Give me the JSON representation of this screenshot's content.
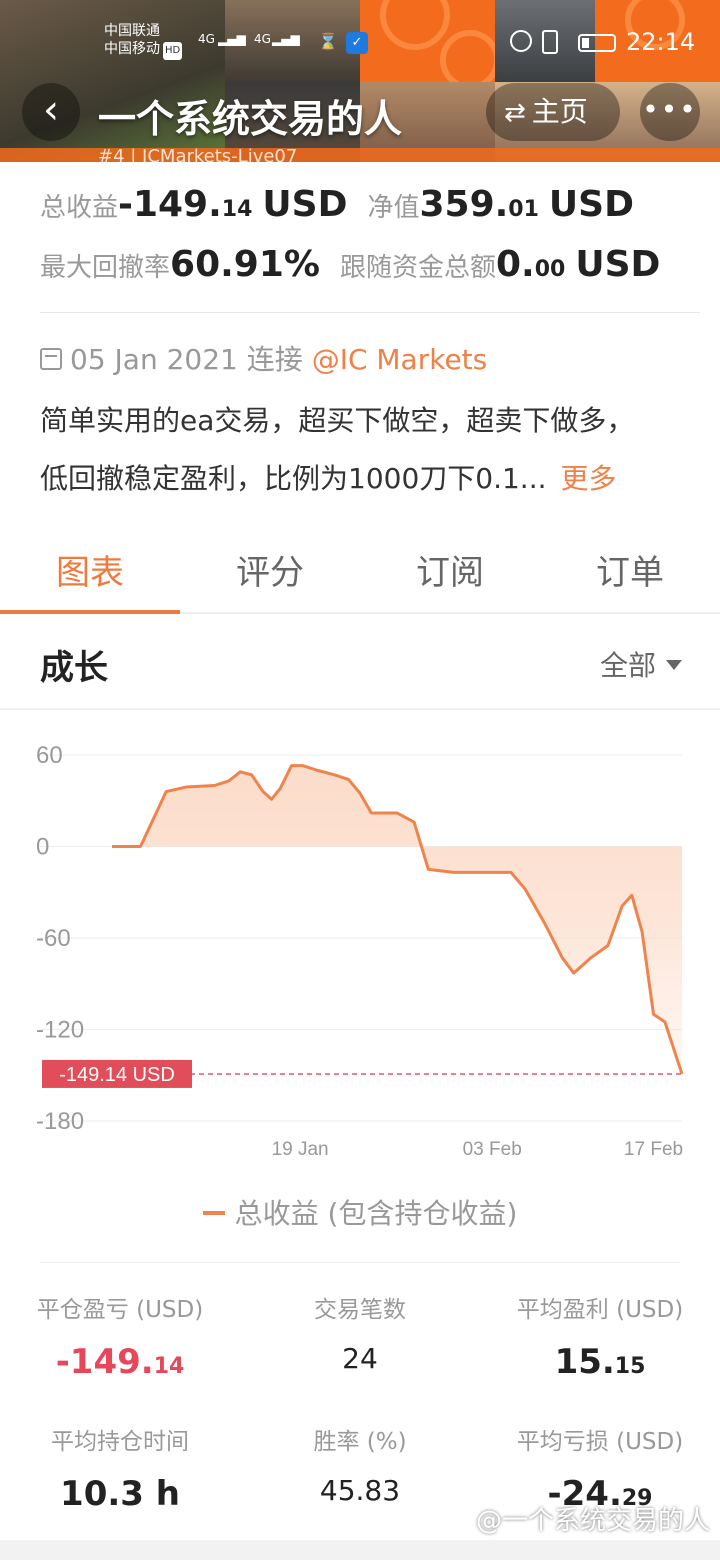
{
  "status_bar": {
    "carrier_1": "中国联通",
    "carrier_2": "中国移动",
    "hd": "HD",
    "network_1": "4G",
    "network_2": "4G",
    "time": "22:14"
  },
  "nav": {
    "title": "一个系统交易的人",
    "home_label": "主页",
    "subtitle": "#4 | ICMarkets-Live07"
  },
  "stats": {
    "total_profit_label": "总收益",
    "total_profit_int": "-149.",
    "total_profit_dec": "14",
    "total_profit_unit": "USD",
    "equity_label": "净值",
    "equity_int": "359.",
    "equity_dec": "01",
    "equity_unit": "USD",
    "max_drawdown_label": "最大回撤率",
    "max_drawdown_value": "60.91%",
    "follow_funds_label": "跟随资金总额",
    "follow_funds_int": "0.",
    "follow_funds_dec": "00",
    "follow_funds_unit": "USD"
  },
  "connect": {
    "date": "05 Jan 2021",
    "text": "连接",
    "broker": "@IC Markets"
  },
  "description": {
    "line1": "简单实用的ea交易，超买下做空，超卖下做多，",
    "line2": "低回撤稳定盈利，比例为1000刀下0.1...",
    "more": "更多"
  },
  "tabs": [
    {
      "label": "图表",
      "active": true
    },
    {
      "label": "评分",
      "active": false
    },
    {
      "label": "订阅",
      "active": false
    },
    {
      "label": "订单",
      "active": false
    }
  ],
  "growth": {
    "title": "成长",
    "range": "全部"
  },
  "chart_data": {
    "type": "area",
    "y_ticks": [
      "60",
      "0",
      "-60",
      "-120",
      "-180"
    ],
    "ylim": [
      -180,
      60
    ],
    "x_ticks": [
      "19 Jan",
      "03 Feb",
      "17 Feb"
    ],
    "current_label": "-149.14 USD",
    "current_value": -149.14,
    "legend": "总收益 (包含持仓收益)",
    "line_color": "#f0834b",
    "fill_color": "#fbd0b8",
    "series": [
      {
        "name": "总收益 (包含持仓收益)",
        "points": [
          [
            0.0,
            0
          ],
          [
            0.05,
            0
          ],
          [
            0.075,
            20
          ],
          [
            0.095,
            36
          ],
          [
            0.13,
            39
          ],
          [
            0.18,
            40
          ],
          [
            0.205,
            43
          ],
          [
            0.225,
            49
          ],
          [
            0.245,
            47
          ],
          [
            0.265,
            36
          ],
          [
            0.28,
            31
          ],
          [
            0.295,
            38
          ],
          [
            0.315,
            53
          ],
          [
            0.335,
            53
          ],
          [
            0.36,
            50
          ],
          [
            0.39,
            47
          ],
          [
            0.415,
            44
          ],
          [
            0.435,
            35
          ],
          [
            0.455,
            22
          ],
          [
            0.5,
            22
          ],
          [
            0.53,
            16
          ],
          [
            0.555,
            -15
          ],
          [
            0.6,
            -17
          ],
          [
            0.7,
            -17
          ],
          [
            0.725,
            -28
          ],
          [
            0.76,
            -51
          ],
          [
            0.79,
            -73
          ],
          [
            0.81,
            -83
          ],
          [
            0.84,
            -73
          ],
          [
            0.87,
            -65
          ],
          [
            0.895,
            -39
          ],
          [
            0.912,
            -32
          ],
          [
            0.93,
            -56
          ],
          [
            0.95,
            -110
          ],
          [
            0.97,
            -115
          ],
          [
            1.0,
            -149.14
          ]
        ]
      }
    ]
  },
  "summary": {
    "closed_pl_label": "平仓盈亏 (USD)",
    "closed_pl_int": "-149.",
    "closed_pl_dec": "14",
    "trades_label": "交易笔数",
    "trades_value": "24",
    "avg_profit_label": "平均盈利 (USD)",
    "avg_profit_int": "15.",
    "avg_profit_dec": "15",
    "avg_hold_label": "平均持仓时间",
    "avg_hold_value": "10.3 h",
    "win_rate_label": "胜率 (%)",
    "win_rate_value": "45.83",
    "avg_loss_label": "平均亏损 (USD)",
    "avg_loss_int": "-24.",
    "avg_loss_dec": "29"
  },
  "watermark": "@一个系统交易的人"
}
